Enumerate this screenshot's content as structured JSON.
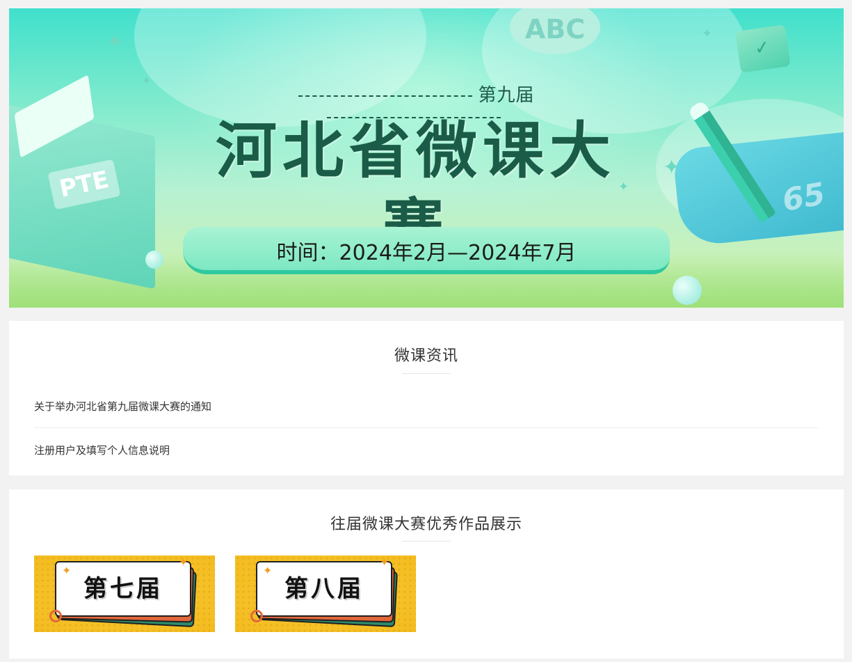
{
  "banner": {
    "edition": "第九届",
    "title": "河北省微课大赛",
    "date": "时间：2024年2月—2024年7月",
    "decor": {
      "abc_text": "ABC",
      "book_label": "PTE",
      "paper_number": "65"
    }
  },
  "news": {
    "title": "微课资讯",
    "items": [
      {
        "label": "关于举办河北省第九届微课大赛的通知"
      },
      {
        "label": "注册用户及填写个人信息说明"
      }
    ]
  },
  "works": {
    "title": "往届微课大赛优秀作品展示",
    "tiles": [
      {
        "label": "第七届"
      },
      {
        "label": "第八届"
      }
    ]
  },
  "colors": {
    "page_bg": "#f2f2f2",
    "banner_title": "#1a5c47",
    "tile_yellow": "#f6c52b",
    "accent_green": "#2fc9a0"
  }
}
